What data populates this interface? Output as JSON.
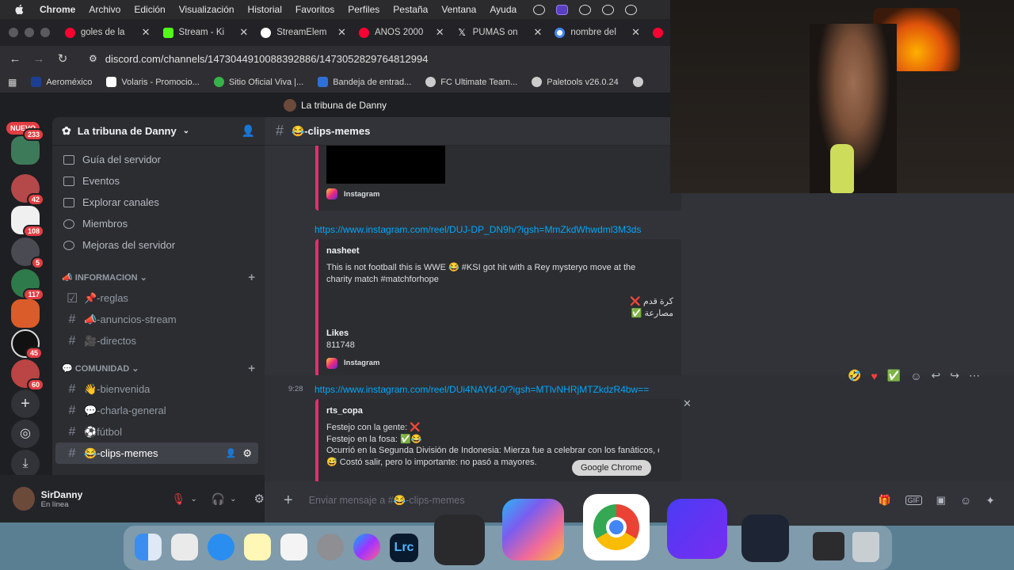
{
  "menubar": {
    "app": "Chrome",
    "items": [
      "Archivo",
      "Edición",
      "Visualización",
      "Historial",
      "Favoritos",
      "Perfiles",
      "Pestaña",
      "Ventana",
      "Ayuda"
    ]
  },
  "tabs": [
    {
      "title": "goles de la",
      "color": "#ff0033"
    },
    {
      "title": "Stream - Ki",
      "color": "#53fc18"
    },
    {
      "title": "StreamElem",
      "color": "#ffffff"
    },
    {
      "title": "AÑOS 2000",
      "color": "#ff0033"
    },
    {
      "title": "PUMAS on",
      "color": "#000000"
    },
    {
      "title": "nombre del",
      "color": "#4285f4"
    }
  ],
  "address": {
    "url": "discord.com/channels/1473044910088392886/1473052829764812994"
  },
  "bookmarks": [
    {
      "label": "Aeroméxico",
      "color": "#1c3f94"
    },
    {
      "label": "Volaris - Promocio...",
      "color": "#a4197a"
    },
    {
      "label": "Sitio Oficial Viva |...",
      "color": "#38b24a"
    },
    {
      "label": "Bandeja de entrad...",
      "color": "#2f6fd8"
    },
    {
      "label": "FC Ultimate Team...",
      "color": "#cccccc"
    },
    {
      "label": "Paletools v26.0.24",
      "color": "#cccccc"
    }
  ],
  "discord": {
    "window_title": "La tribuna de Danny",
    "nuevo": "NUEVO",
    "guild_badges": [
      "233",
      "42",
      "108",
      "5",
      "117",
      "45",
      "60"
    ],
    "server_name": "La tribuna de Danny",
    "nav": [
      "Guía del servidor",
      "Eventos",
      "Explorar canales",
      "Miembros",
      "Mejoras del servidor"
    ],
    "cat1": "INFORMACION",
    "cat1_channels": [
      "📌-reglas",
      "📣-anuncios-stream",
      "🎥-directos"
    ],
    "cat2": "COMUNIDAD",
    "cat2_channels": [
      "👋-bienvenida",
      "💬-charla-general",
      "⚽fútbol",
      "😂-clips-memes"
    ],
    "user": {
      "name": "SirDanny",
      "status": "En línea"
    },
    "channel_header": "😂-clips-memes",
    "messages": {
      "embed0_source": "Instagram",
      "link1": "https://www.instagram.com/reel/DUJ-DP_DN9h/?igsh=MmZkdWhwdml3M3ds",
      "embed1_author": "nasheet",
      "embed1_text": "This is not football this is WWE 😂 #KSI got hit with a Rey mysteryo move at the charity match #matchforhope",
      "embed1_ar1": "كرة قدم ❌",
      "embed1_ar2": "مصارعة ✅",
      "embed1_field_name": "Likes",
      "embed1_field_value": "811748",
      "embed1_source": "Instagram",
      "time2": "9:28",
      "link2": "https://www.instagram.com/reel/DUi4NAYkf-0/?igsh=MTlvNHRjMTZkdzR4bw==",
      "embed2_author": "rts_copa",
      "embed2_l1": "Festejo con la gente: ❌",
      "embed2_l2": "Festejo en la fosa: ✅😂",
      "embed2_l3": "Ocurrió en la Segunda División de Indonesia: Mierza fue a celebrar con los fanáticos, olvidó la fosa del estadio Utama Sumut y terminó",
      "embed2_l4": "😅 Costó salir, pero lo importante: no pasó a mayores."
    },
    "composer_placeholder": "Enviar mensaje a #😂-clips-memes"
  },
  "tooltip": "Google Chrome",
  "dock_apps": [
    "finder",
    "launchpad",
    "safari",
    "notes",
    "freeform",
    "settings",
    "messenger",
    "lightroom-classic",
    "calculator",
    "copilot",
    "chrome",
    "launcher",
    "obs",
    "window",
    "trash"
  ]
}
